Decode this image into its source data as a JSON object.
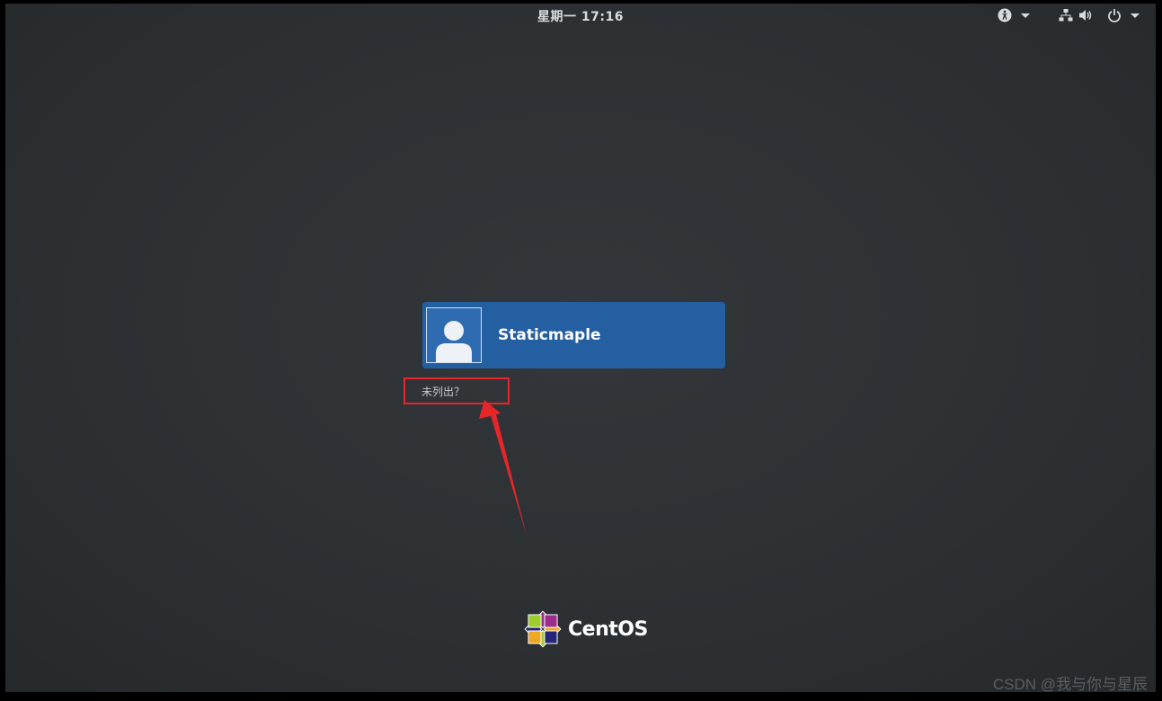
{
  "topbar": {
    "clock_day": "星期一",
    "clock_time": "17:16"
  },
  "icons": {
    "accessibility": "accessibility-icon",
    "network": "network-icon",
    "volume": "volume-icon",
    "power": "power-icon"
  },
  "login": {
    "user_name": "Staticmaple",
    "not_listed": "未列出？"
  },
  "branding": {
    "logo_text": "CentOS"
  },
  "watermark": "CSDN @我与你与星辰",
  "colors": {
    "background": "#2c3033",
    "user_card": "#245fa2",
    "annotation": "#e8262a"
  }
}
